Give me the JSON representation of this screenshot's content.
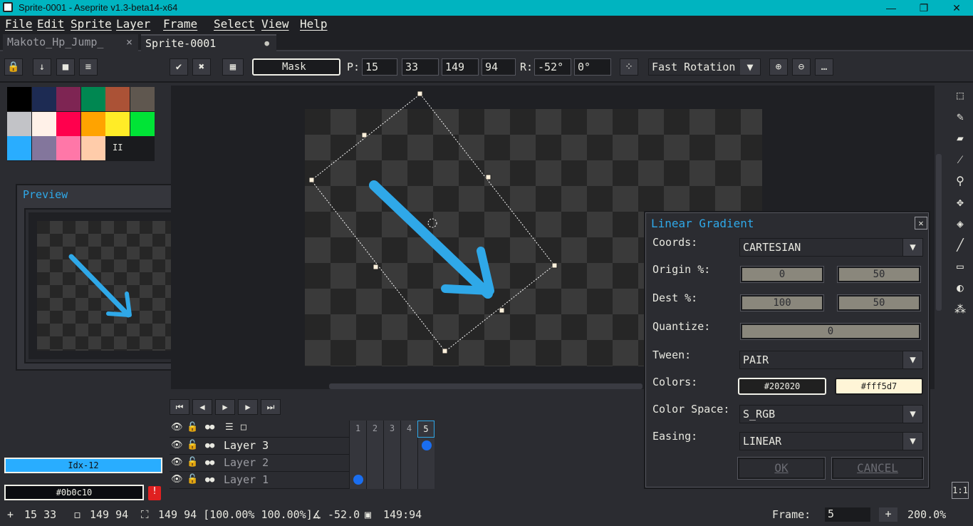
{
  "window": {
    "title": "Sprite-0001 - Aseprite v1.3-beta14-x64",
    "minimize": "—",
    "maximize": "❐",
    "close": "✕"
  },
  "menu": [
    "File",
    "Edit",
    "Sprite",
    "Layer",
    "Frame",
    "Select",
    "View",
    "Help"
  ],
  "tabs": [
    {
      "label": "Makoto_Hp_Jump_",
      "close": "×"
    },
    {
      "label": "Sprite-0001",
      "dot": "●"
    }
  ],
  "toolbar": {
    "mask_label": "Mask",
    "position_label": "P:",
    "x": "15",
    "y": "33",
    "w": "149",
    "h": "94",
    "rotation_label": "R:",
    "angle": "-52°",
    "skew": "0°",
    "algorithm": "Fast Rotation",
    "more": "…"
  },
  "palette": {
    "colors": [
      "#000000",
      "#1d2b53",
      "#7e2553",
      "#008751",
      "#ab5236",
      "#5f574f",
      "#c2c3c7",
      "#fff1e8",
      "#ff004d",
      "#ffa300",
      "#ffec27",
      "#00e436",
      "#29adff",
      "#83769c",
      "#ff77a8",
      "#ffccaa"
    ],
    "more_glyph": "II"
  },
  "preview": {
    "title": "Preview"
  },
  "color_indicators": {
    "fg_label": "Idx-12",
    "fg_color": "#29adff",
    "bg_label": "#0b0c10",
    "warning": "!"
  },
  "timeline": {
    "frames": [
      "1",
      "2",
      "3",
      "4",
      "5"
    ],
    "layers": [
      {
        "name": "Layer 3",
        "active": true
      },
      {
        "name": "Layer 2",
        "active": false
      },
      {
        "name": "Layer 1",
        "active": false
      }
    ]
  },
  "dialog": {
    "title": "Linear Gradient",
    "close": "✕",
    "coords_label": "Coords:",
    "coords_value": "CARTESIAN",
    "origin_label": "Origin %:",
    "origin_x": "0",
    "origin_y": "50",
    "dest_label": "Dest %:",
    "dest_x": "100",
    "dest_y": "50",
    "quantize_label": "Quantize:",
    "quantize_value": "0",
    "tween_label": "Tween:",
    "tween_value": "PAIR",
    "colors_label": "Colors:",
    "color_a": "#202020",
    "color_b": "#fff5d7",
    "colorspace_label": "Color Space:",
    "colorspace_value": "S_RGB",
    "easing_label": "Easing:",
    "easing_value": "LINEAR",
    "ok": "OK",
    "cancel": "CANCEL"
  },
  "status": {
    "pos": "15 33",
    "size": "149   94",
    "sel": "149 94 [100.00% 100.00%]",
    "angle": "-52.0",
    "ratio": "149:94",
    "frame_label": "Frame:",
    "frame_value": "5",
    "plus": "+",
    "zoom": "200.0%"
  },
  "tools": {
    "ratio_btn": "1:1"
  }
}
